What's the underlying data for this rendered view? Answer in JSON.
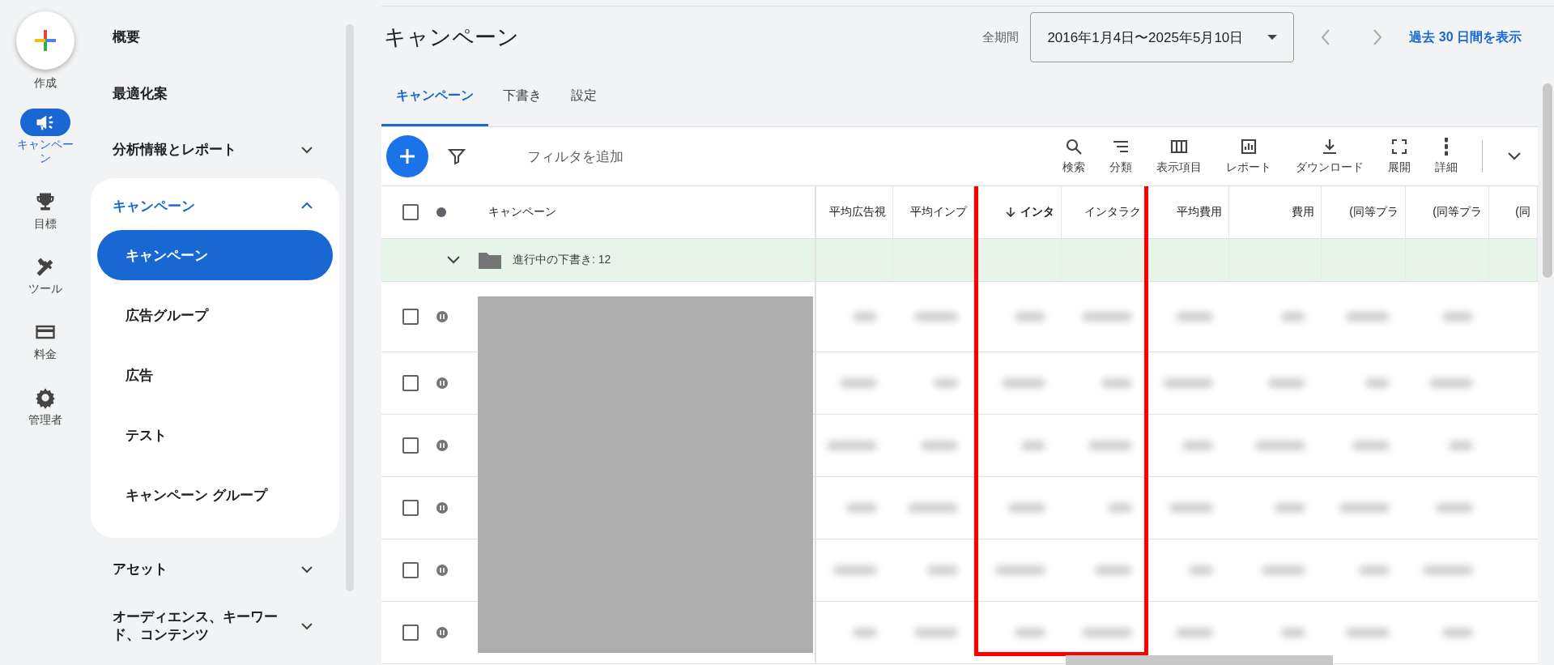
{
  "create_button": {
    "label": "作成"
  },
  "rail": [
    {
      "kind": "campaign",
      "label": "キャンペーン",
      "selected": true
    },
    {
      "kind": "goals",
      "label": "目標",
      "selected": false
    },
    {
      "kind": "tools",
      "label": "ツール",
      "selected": false
    },
    {
      "kind": "billing",
      "label": "料金",
      "selected": false
    },
    {
      "kind": "admin",
      "label": "管理者",
      "selected": false
    }
  ],
  "sidebar": {
    "items": [
      {
        "kind": "link",
        "label": "概要"
      },
      {
        "kind": "link",
        "label": "最適化案"
      },
      {
        "kind": "group",
        "label": "分析情報とレポート",
        "expanded": false
      },
      {
        "kind": "group",
        "label": "キャンペーン",
        "expanded": true,
        "children": [
          {
            "label": "キャンペーン",
            "selected": true
          },
          {
            "label": "広告グループ",
            "selected": false
          },
          {
            "label": "広告",
            "selected": false
          },
          {
            "label": "テスト",
            "selected": false
          },
          {
            "label": "キャンペーン グループ",
            "selected": false
          }
        ]
      },
      {
        "kind": "group",
        "label": "アセット",
        "expanded": false
      },
      {
        "kind": "group",
        "label": "オーディエンス、キーワード、コンテンツ",
        "expanded": false
      }
    ]
  },
  "header": {
    "title": "キャンペーン",
    "period_label": "全期間",
    "date_range": "2016年1月4日〜2025年5月10日",
    "show_last_30": "過去 30 日間を表示"
  },
  "tabs": [
    {
      "label": "キャンペーン",
      "selected": true
    },
    {
      "label": "下書き",
      "selected": false
    },
    {
      "label": "設定",
      "selected": false
    }
  ],
  "toolbar": {
    "filter_placeholder": "フィルタを追加",
    "actions": [
      {
        "kind": "search",
        "label": "検索"
      },
      {
        "kind": "segment",
        "label": "分類"
      },
      {
        "kind": "columns",
        "label": "表示項目"
      },
      {
        "kind": "report",
        "label": "レポート"
      },
      {
        "kind": "download",
        "label": "ダウンロード"
      },
      {
        "kind": "expand",
        "label": "展開"
      },
      {
        "kind": "more",
        "label": "詳細"
      }
    ]
  },
  "table": {
    "name_column": "キャンペーン",
    "columns": [
      {
        "label": "平均広告視",
        "sorted": false,
        "highlighted": false
      },
      {
        "label": "平均インプ",
        "sorted": false,
        "highlighted": false
      },
      {
        "label": "インタ",
        "sorted": true,
        "highlighted": true
      },
      {
        "label": "インタラク",
        "sorted": false,
        "highlighted": true
      },
      {
        "label": "平均費用",
        "sorted": false,
        "highlighted": false
      },
      {
        "label": "費用",
        "sorted": false,
        "highlighted": false
      },
      {
        "label": "(同等プラ",
        "sorted": false,
        "highlighted": false
      },
      {
        "label": "(同等プラ",
        "sorted": false,
        "highlighted": false
      },
      {
        "label": "(同",
        "sorted": false,
        "highlighted": false
      }
    ],
    "draft_row": {
      "label": "進行中の下書き: 12",
      "expanded": false
    },
    "select_all_checked": false,
    "rows": [
      {
        "checked": false,
        "paused": true
      },
      {
        "checked": false,
        "paused": true
      },
      {
        "checked": false,
        "paused": true
      },
      {
        "checked": false,
        "paused": true
      },
      {
        "checked": false,
        "paused": true
      },
      {
        "checked": false,
        "paused": true
      }
    ]
  }
}
